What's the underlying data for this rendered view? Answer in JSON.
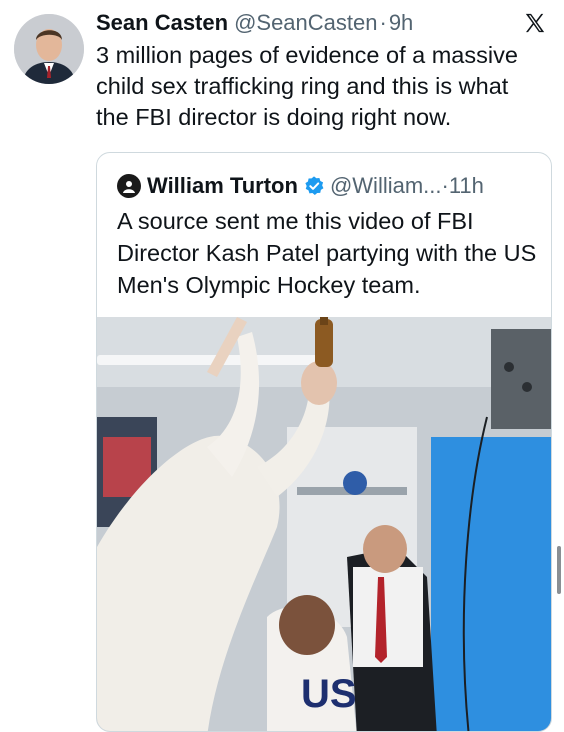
{
  "tweet": {
    "author_name": "Sean Casten",
    "handle": "@SeanCasten",
    "separator": "·",
    "time": "9h",
    "text": "3 million pages of evidence of a massive child sex trafficking ring and this is what the FBI director is doing right now.",
    "platform_icon": "x-logo-icon",
    "avatar": "avatar-photo"
  },
  "quoted_tweet": {
    "author_name": "William Turton",
    "verified": true,
    "verified_color": "#1d9bf0",
    "handle": "@William...",
    "separator": "·",
    "time": "11h",
    "text": "A source sent me this video of FBI Director Kash Patel partying with the US Men's Olympic Hockey team.",
    "media_type": "video-still"
  },
  "colors": {
    "text_primary": "#0f1419",
    "text_secondary": "#536471",
    "border": "#cfd9de",
    "background": "#ffffff"
  }
}
